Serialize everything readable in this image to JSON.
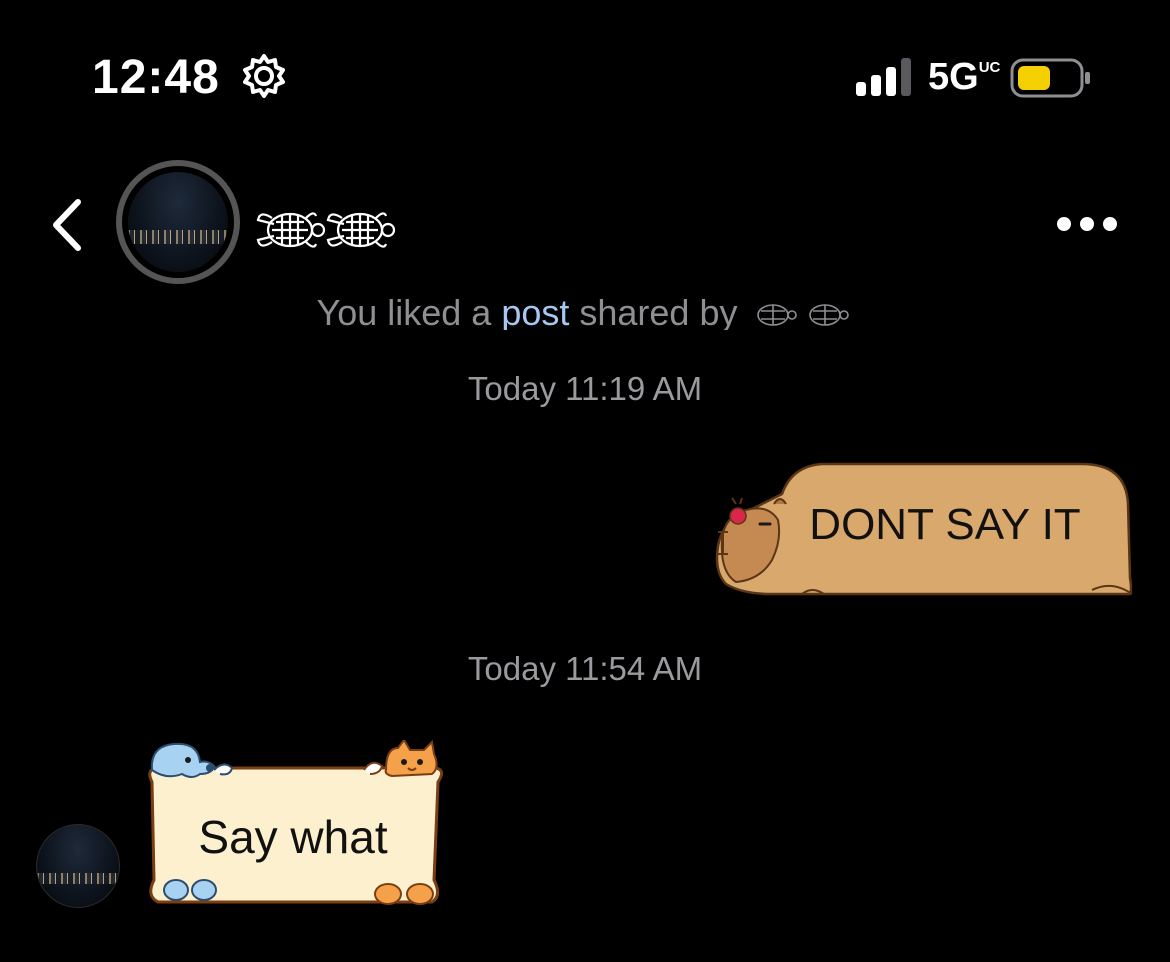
{
  "status_bar": {
    "time": "12:48",
    "network": "5G",
    "network_suffix": "UC",
    "battery_color": "#f5d000"
  },
  "header": {
    "contact_display": "turtle-emoji-x2",
    "icons": [
      "chevron-left-icon",
      "more-horizontal-icon"
    ]
  },
  "chat": {
    "system_message": {
      "prefix": "You liked a ",
      "link": "post",
      "suffix": " shared by "
    },
    "timestamps": [
      "Today 11:19 AM",
      "Today 11:54 AM"
    ],
    "messages": [
      {
        "direction": "outgoing",
        "text": "DONT SAY IT",
        "bubble_color": "#d9a86c"
      },
      {
        "direction": "incoming",
        "text": "Say what",
        "bubble_color": "#fdf0cf"
      }
    ]
  }
}
